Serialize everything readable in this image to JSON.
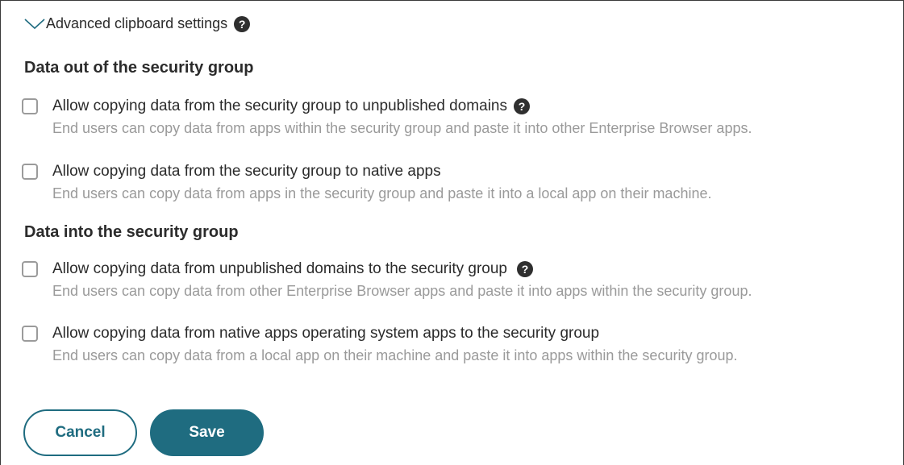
{
  "advanced": {
    "toggle_label": "Advanced clipboard settings",
    "chevron_icon": "chevron-down-icon",
    "help_icon": "help-icon",
    "help_glyph": "?"
  },
  "groups": [
    {
      "heading": "Data out of the security group",
      "options": [
        {
          "label": "Allow copying data from the security group to unpublished domains",
          "description": "End users can copy data from apps within the security group and paste it into other Enterprise Browser apps.",
          "has_help": true,
          "checked": false
        },
        {
          "label": "Allow copying data from the security group to native apps",
          "description": "End users can copy data from apps in the security group and paste it into a local app on their machine.",
          "has_help": false,
          "checked": false
        }
      ]
    },
    {
      "heading": "Data into the security group",
      "options": [
        {
          "label": "Allow copying data from unpublished domains to the security group",
          "description": "End users can copy data from other Enterprise Browser apps and paste it into apps within the security group.",
          "has_help": true,
          "checked": false
        },
        {
          "label": "Allow copying data from native apps operating system apps to the security group",
          "description": "End users can copy data from a local app on their machine and paste it into apps within the security group.",
          "has_help": false,
          "checked": false
        }
      ]
    }
  ],
  "actions": {
    "cancel_label": "Cancel",
    "save_label": "Save"
  },
  "colors": {
    "accent": "#1f6c80",
    "text": "#2b2b2b",
    "muted": "#9a9a9a",
    "checkbox_border": "#9b9b9b"
  }
}
